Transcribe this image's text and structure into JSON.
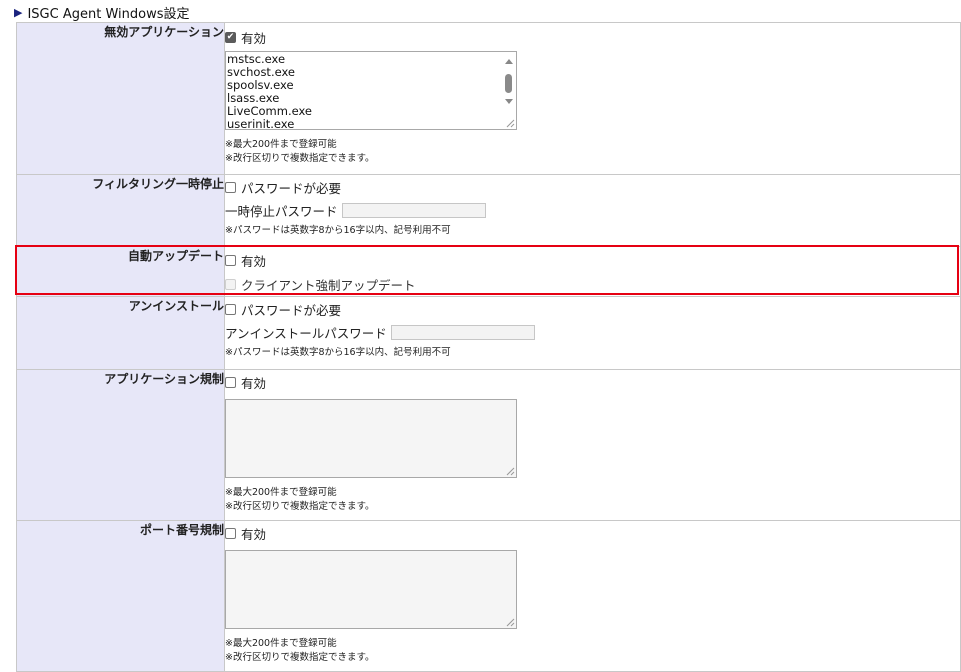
{
  "section": {
    "title": "ISGC Agent Windows設定"
  },
  "colors": {
    "label_bg": "#e7e7f8",
    "highlight": "#e60012",
    "title_marker": "#1a237e"
  },
  "rows": {
    "disabled_apps": {
      "label": "無効アプリケーション",
      "enable_label": "有効",
      "enabled": true,
      "textarea_lines": [
        "mstsc.exe",
        "svchost.exe",
        "spoolsv.exe",
        "lsass.exe",
        "LiveComm.exe",
        "userinit.exe"
      ],
      "note1": "※最大200件まで登録可能",
      "note2": "※改行区切りで複数指定できます。"
    },
    "filtering_pause": {
      "label": "フィルタリング一時停止",
      "pw_required_label": "パスワードが必要",
      "pw_required": false,
      "pw_label": "一時停止パスワード",
      "note": "※パスワードは英数字8から16字以内、記号利用不可"
    },
    "auto_update": {
      "label": "自動アップデート",
      "enable_label": "有効",
      "enabled": false,
      "force_label": "クライアント強制アップデート",
      "force_enabled": false
    },
    "uninstall": {
      "label": "アンインストール",
      "pw_required_label": "パスワードが必要",
      "pw_required": false,
      "pw_label": "アンインストールパスワード",
      "note": "※パスワードは英数字8から16字以内、記号利用不可"
    },
    "app_restriction": {
      "label": "アプリケーション規制",
      "enable_label": "有効",
      "enabled": false,
      "note1": "※最大200件まで登録可能",
      "note2": "※改行区切りで複数指定できます。"
    },
    "port_restriction": {
      "label": "ポート番号規制",
      "enable_label": "有効",
      "enabled": false,
      "note1": "※最大200件まで登録可能",
      "note2": "※改行区切りで複数指定できます。"
    }
  }
}
